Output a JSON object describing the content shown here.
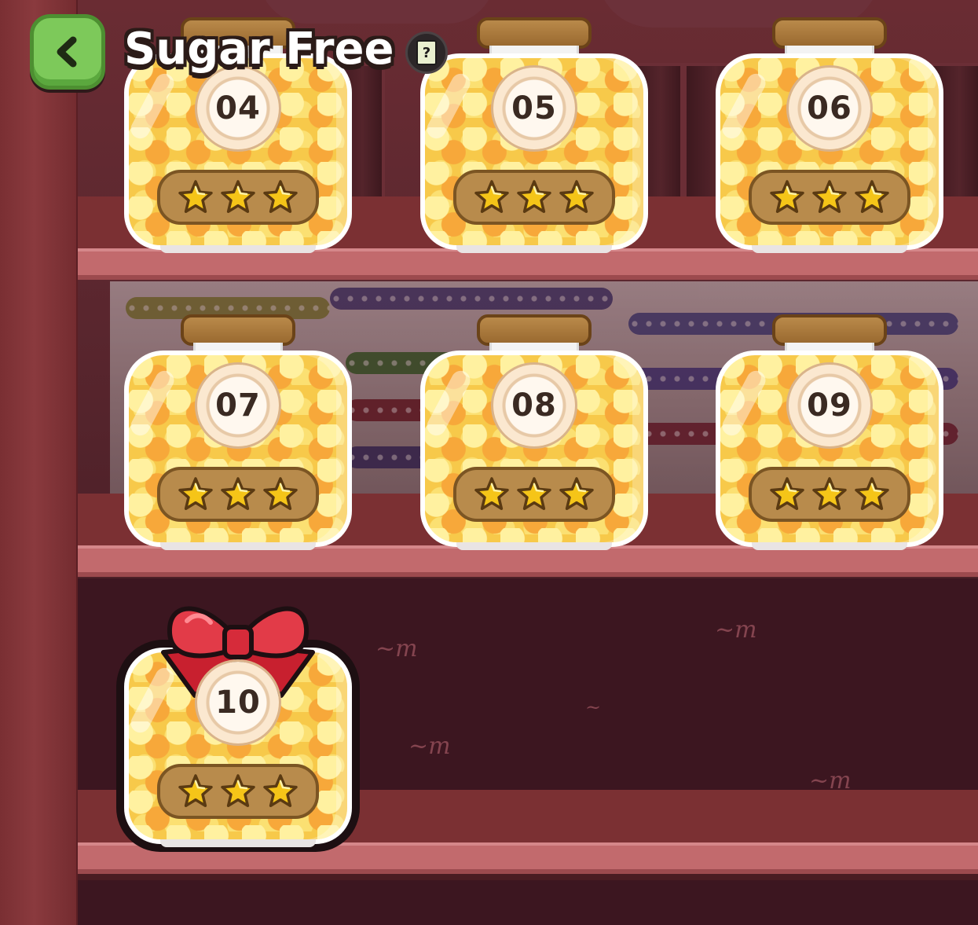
{
  "header": {
    "title": "Sugar Free",
    "back_icon": "chevron-left-icon",
    "help_icon": "question-book-icon",
    "help_glyph": "?"
  },
  "colors": {
    "back_button": "#7dc95a",
    "shelf": "#c26a6d",
    "wall": "#5e2830",
    "candy_yellow": "#f7c94a",
    "star_gold": "#f5c518",
    "bow_red": "#d62b3a"
  },
  "levels": [
    {
      "number": "04",
      "stars": 3,
      "max_stars": 3
    },
    {
      "number": "05",
      "stars": 3,
      "max_stars": 3
    },
    {
      "number": "06",
      "stars": 3,
      "max_stars": 3
    },
    {
      "number": "07",
      "stars": 3,
      "max_stars": 3
    },
    {
      "number": "08",
      "stars": 3,
      "max_stars": 3
    },
    {
      "number": "09",
      "stars": 3,
      "max_stars": 3
    },
    {
      "number": "10",
      "stars": 3,
      "max_stars": 3,
      "gift_bow": true
    }
  ]
}
